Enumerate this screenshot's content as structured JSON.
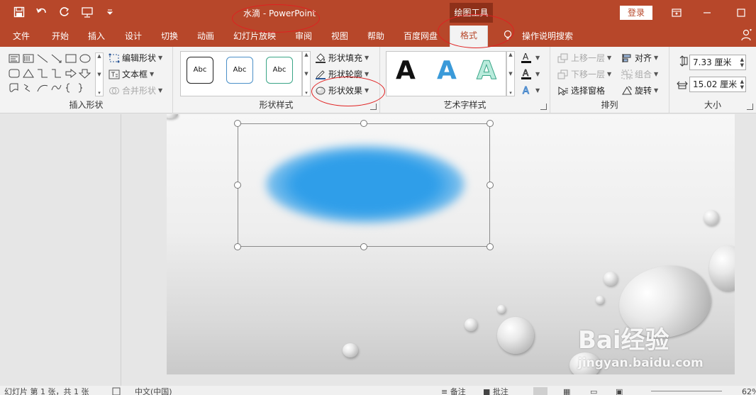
{
  "window": {
    "title": "水滴  -  PowerPoint",
    "context_tab_group": "绘图工具",
    "signin_label": "登录"
  },
  "tabs": [
    {
      "label": "文件"
    },
    {
      "label": "开始"
    },
    {
      "label": "插入"
    },
    {
      "label": "设计"
    },
    {
      "label": "切换"
    },
    {
      "label": "动画"
    },
    {
      "label": "幻灯片放映"
    },
    {
      "label": "审阅"
    },
    {
      "label": "视图"
    },
    {
      "label": "帮助"
    },
    {
      "label": "百度网盘"
    },
    {
      "label": "格式",
      "active": true
    }
  ],
  "tell_me": "操作说明搜索",
  "ribbon": {
    "insert_shapes": {
      "edit_shape": "编辑形状",
      "text_box": "文本框",
      "merge_shapes": "合并形状",
      "label": "插入形状"
    },
    "shape_styles": {
      "gallery": [
        "Abc",
        "Abc",
        "Abc"
      ],
      "shape_fill": "形状填充",
      "shape_outline": "形状轮廓",
      "shape_effects": "形状效果",
      "label": "形状样式"
    },
    "wordart_styles": {
      "gallery": [
        "A",
        "A",
        "A"
      ],
      "label": "艺术字样式"
    },
    "arrange": {
      "bring_forward": "上移一层",
      "send_backward": "下移一层",
      "selection_pane": "选择窗格",
      "align": "对齐",
      "group": "组合",
      "rotate": "旋转",
      "label": "排列"
    },
    "size": {
      "height": "7.33 厘米",
      "width": "15.02 厘米",
      "label": "大小"
    }
  },
  "watermark": {
    "brand": "Bai经验",
    "url": "jingyan.baidu.com"
  },
  "status_bar": {
    "slide_info": "幻灯片 第 1 张，共 1 张",
    "language": "中文(中国)",
    "notes": "备注",
    "comments": "批注",
    "zoom": "62%"
  },
  "colors": {
    "accent": "#b7472a",
    "blob": "#2f9ee9",
    "annotation": "#e02020"
  }
}
